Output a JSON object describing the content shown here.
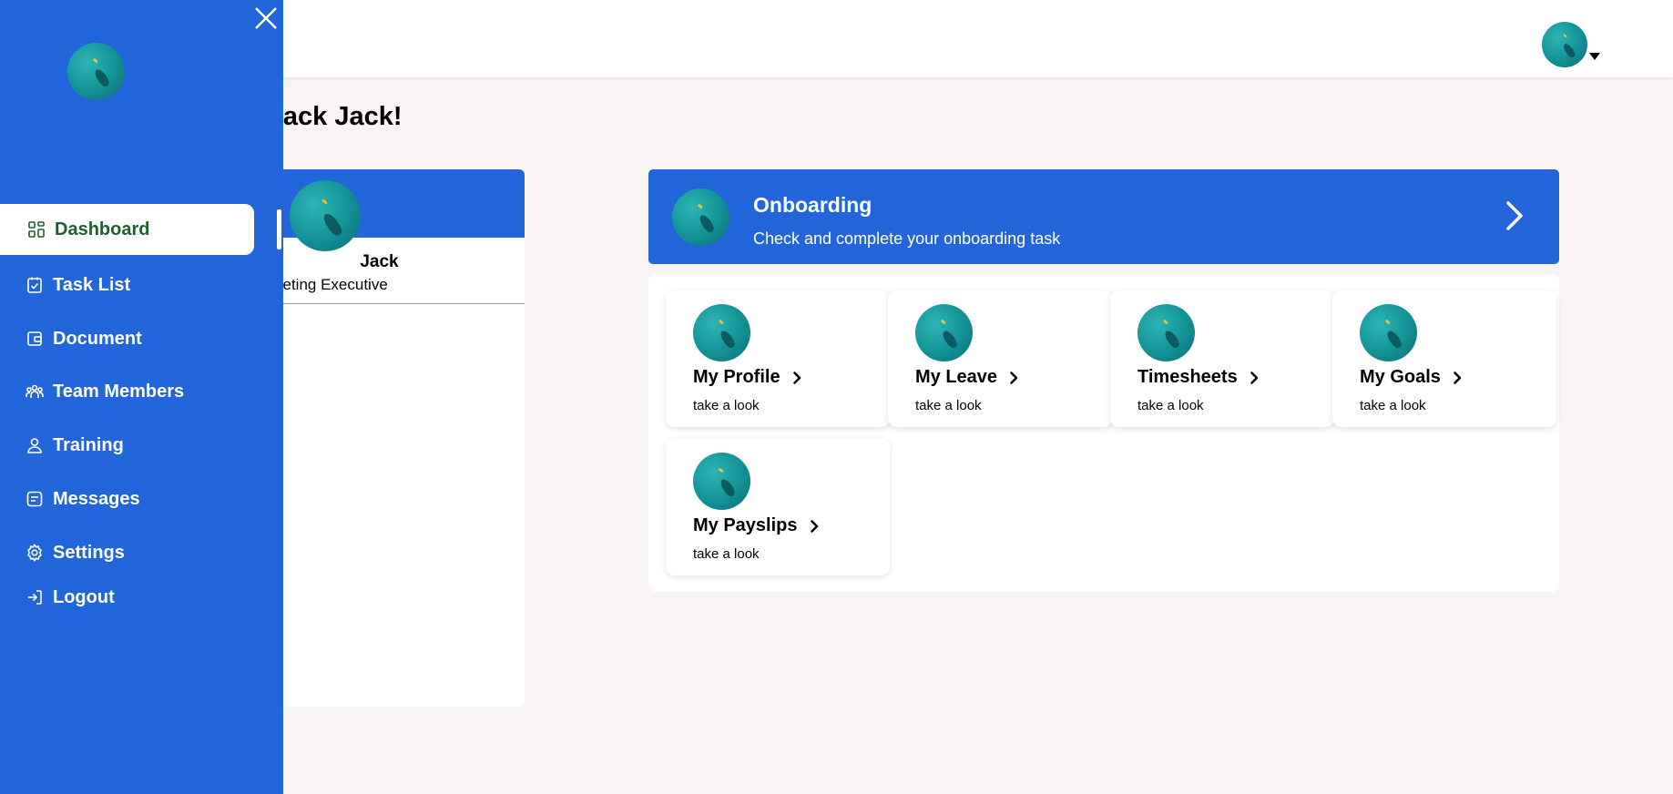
{
  "sidebar": {
    "items": [
      {
        "label": "Dashboard",
        "icon": "dashboard-icon",
        "active": true
      },
      {
        "label": "Task List",
        "icon": "task-list-icon"
      },
      {
        "label": "Document",
        "icon": "document-icon"
      },
      {
        "label": "Team Members",
        "icon": "team-icon"
      },
      {
        "label": "Training",
        "icon": "user-icon"
      },
      {
        "label": "Messages",
        "icon": "message-icon"
      },
      {
        "label": "Settings",
        "icon": "gear-icon"
      },
      {
        "label": "Logout",
        "icon": "logout-icon"
      }
    ]
  },
  "header": {
    "welcome": "me Back Jack!"
  },
  "profile": {
    "name": "Jack",
    "role": "keting Executive"
  },
  "onboarding": {
    "title": "Onboarding",
    "subtitle": "Check and complete your onboarding task"
  },
  "tiles": [
    {
      "title": "My Profile",
      "subtitle": "take a look"
    },
    {
      "title": "My Leave",
      "subtitle": "take a look"
    },
    {
      "title": "Timesheets",
      "subtitle": "take a look"
    },
    {
      "title": "My Goals",
      "subtitle": "take a look"
    },
    {
      "title": "My Payslips",
      "subtitle": "take a look"
    }
  ],
  "colors": {
    "brand": "#2366dc",
    "active_text": "#1f5f2d",
    "background": "#f7f4f3"
  }
}
